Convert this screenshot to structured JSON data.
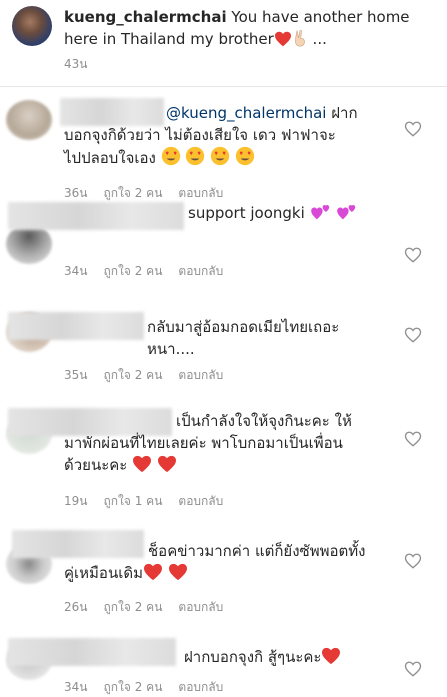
{
  "header": {
    "username": "kueng_chalermchai",
    "caption": " You have another home here in Thailand my brother",
    "caption_tail": " ...",
    "time": "43น"
  },
  "comments": [
    {
      "mention": "@kueng_chalermchai",
      "text_line1": " ฝาก",
      "text_rest": "บอกจุงกิด้วยว่า ไม่ต้องเสียใจ เดว ฟาฟาจะ\nไปปลอบใจเอง",
      "time": "36น",
      "likes": "ถูกใจ 2 คน",
      "reply": "ตอบกลับ"
    },
    {
      "text": "support joongki",
      "time": "34น",
      "likes": "ถูกใจ 2 คน",
      "reply": "ตอบกลับ"
    },
    {
      "text": "กลับมาสู่อ้อมกอดเมียไทยเถอะ\nหนา....",
      "time": "35น",
      "likes": "ถูกใจ 2 คน",
      "reply": "ตอบกลับ"
    },
    {
      "text": "เป็นกำลังใจให้จุงกินะคะ ให้\nมาพักผ่อนที่ไทยเลยค่ะ พาโบกอมาเป็นเพื่อน\nด้วยนะคะ",
      "time": "19น",
      "likes": "ถูกใจ 1 คน",
      "reply": "ตอบกลับ"
    },
    {
      "text": "ช็อคข่าวมากค่า แต่ก็ยังซัพพอตทั้ง\nคู่เหมือนเดิม",
      "time": "26น",
      "likes": "ถูกใจ 2 คน",
      "reply": "ตอบกลับ"
    },
    {
      "text": "ฝากบอกจุงกิ สู้ๆนะคะ",
      "time": "34น",
      "likes": "ถูกใจ 2 คน",
      "reply": "ตอบกลับ"
    }
  ],
  "icons": {
    "like": "heart-outline-icon",
    "red_heart": "red-heart-emoji",
    "pink_hearts": "two-hearts-emoji",
    "heart_eyes": "heart-eyes-emoji",
    "victory": "victory-hand-emoji"
  },
  "colors": {
    "text": "#262626",
    "meta": "#8e8e8e",
    "mention": "#003569",
    "heart": "#ed4956",
    "pink": "#d84ad6",
    "emoji_face": "#fbc02d"
  }
}
